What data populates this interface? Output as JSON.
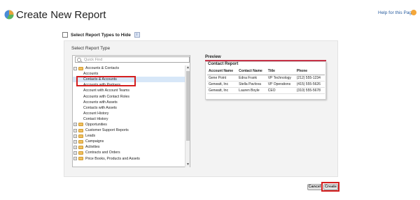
{
  "header": {
    "title": "Create New Report",
    "help_link": "Help for this Page"
  },
  "options": {
    "hide_label": "Select Report Types to Hide",
    "info_glyph": "i"
  },
  "report_type": {
    "label": "Select Report Type",
    "search_placeholder": "Quick Find",
    "tree": [
      {
        "label": "Accounts & Contacts",
        "level": 0,
        "expander": "−"
      },
      {
        "label": "Accounts",
        "level": 1
      },
      {
        "label": "Contacts & Accounts",
        "level": 1,
        "selected": true
      },
      {
        "label": "Accounts with Partners",
        "level": 1
      },
      {
        "label": "Account with Account Teams",
        "level": 1
      },
      {
        "label": "Accounts with Contact Roles",
        "level": 1
      },
      {
        "label": "Accounts with Assets",
        "level": 1
      },
      {
        "label": "Contacts with Assets",
        "level": 1
      },
      {
        "label": "Account History",
        "level": 1
      },
      {
        "label": "Contact History",
        "level": 1
      },
      {
        "label": "Opportunities",
        "level": 0,
        "expander": "+"
      },
      {
        "label": "Customer Support Reports",
        "level": 0,
        "expander": "+"
      },
      {
        "label": "Leads",
        "level": 0,
        "expander": "+"
      },
      {
        "label": "Campaigns",
        "level": 0,
        "expander": "+"
      },
      {
        "label": "Activities",
        "level": 0,
        "expander": "+"
      },
      {
        "label": "Contracts and Orders",
        "level": 0,
        "expander": "+"
      },
      {
        "label": "Price Books, Products and Assets",
        "level": 0,
        "expander": "+"
      }
    ]
  },
  "preview": {
    "label": "Preview",
    "report_name": "Contact Report",
    "columns": [
      "Account Name",
      "Contact Name",
      "Title",
      "Phone"
    ],
    "rows": [
      [
        "Gene Point",
        "Edna Frank",
        "VP Technology",
        "(212) 555-1234"
      ],
      [
        "Genwatt, Inc",
        "Stella Pavlova",
        "VP Operations",
        "(415) 555-5626"
      ],
      [
        "Genwatt, Inc",
        "Lauren Boyle",
        "CEO",
        "(310) 555-5678"
      ]
    ]
  },
  "buttons": {
    "cancel": "Cancel",
    "create": "Create"
  },
  "colors": {
    "accent_red": "#d41e1e",
    "preview_bar": "#c72c41",
    "link_blue": "#2a5d9f"
  }
}
